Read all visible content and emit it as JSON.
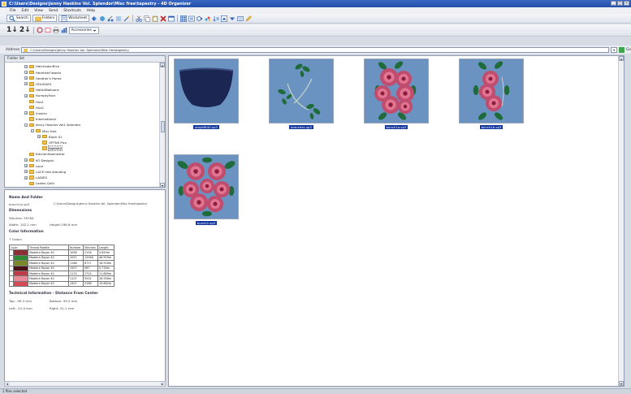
{
  "window": {
    "title": "C:\\Users\\Designs\\Jenny Haskins Vol. Splendor\\Misc free\\tapestry - 4D Organizer",
    "controls": [
      "_",
      "□",
      "×"
    ]
  },
  "menu": [
    "File",
    "Edit",
    "View",
    "Send",
    "Shortcuts",
    "Help"
  ],
  "toolbar1": {
    "search_label": "Search",
    "folders_label": "Folders",
    "worksheet_label": "Worksheet"
  },
  "toolbar2": {
    "sort1_label": "1↓",
    "sort2_label": "2↓",
    "accessories_label": "Accessories"
  },
  "address": {
    "label": "Address",
    "path": "C:\\Users\\Designs\\Jenny Haskins Vol. Splendor\\Misc free\\tapestry",
    "go_label": "Go"
  },
  "folder_list": {
    "header": "Folder list",
    "items": [
      {
        "label": "HatchedsnRice",
        "depth": 1,
        "expander": "+"
      },
      {
        "label": "HeartishFlowers",
        "depth": 1,
        "expander": "+"
      },
      {
        "label": "Heather's Home",
        "depth": 1,
        "expander": "+"
      },
      {
        "label": "HOLIDAYS",
        "depth": 1,
        "expander": "+"
      },
      {
        "label": "HotAirBalloons",
        "depth": 1,
        "expander": ""
      },
      {
        "label": "HumptyFace",
        "depth": 1,
        "expander": "+"
      },
      {
        "label": "Hus1",
        "depth": 1,
        "expander": ""
      },
      {
        "label": "Hus2",
        "depth": 1,
        "expander": ""
      },
      {
        "label": "Insects",
        "depth": 1,
        "expander": "+"
      },
      {
        "label": "International",
        "depth": 1,
        "expander": ""
      },
      {
        "label": "Jenny Haskins Vol1 Splendor",
        "depth": 1,
        "expander": "−"
      },
      {
        "label": "Misc free",
        "depth": 2,
        "expander": "−"
      },
      {
        "label": "Block 01",
        "depth": 3,
        "expander": "+"
      },
      {
        "label": "OPTNS Pics",
        "depth": 3,
        "expander": ""
      },
      {
        "label": "tapestry",
        "depth": 3,
        "expander": "",
        "selected": true
      },
      {
        "label": "KitchenHolenester",
        "depth": 1,
        "expander": ""
      },
      {
        "label": "KO Designs",
        "depth": 1,
        "expander": "+"
      },
      {
        "label": "Lace",
        "depth": 1,
        "expander": "+"
      },
      {
        "label": "LACE free standing",
        "depth": 1,
        "expander": "+"
      },
      {
        "label": "LADIES",
        "depth": 1,
        "expander": "+"
      },
      {
        "label": "Ladies Quilt",
        "depth": 1,
        "expander": ""
      }
    ]
  },
  "info": {
    "name_heading": "Name And Folder",
    "file_name": "bunch1a.vp3",
    "file_path": "C:\\Users\\Designs\\Jenny Haskins Vol. Splendor\\Misc free\\tapestry",
    "dimensions_heading": "Dimensions",
    "stitches": "Stitches: 39784",
    "width": "Width: 102.1 mm",
    "height": "Height:198.8 mm",
    "color_heading": "Color Information",
    "colors_count": "7 Colors",
    "table_headers": [
      "Color",
      "Thread Palette",
      "Number",
      "Stitches",
      "Length"
    ],
    "color_rows": [
      {
        "swatch": "#8a2f35",
        "palette": "Madeira Rayon 40",
        "number": "1058",
        "stitches": "2126",
        "length": "5.829m"
      },
      {
        "swatch": "#2f8a35",
        "palette": "Madeira Rayon 40",
        "number": "1051",
        "stitches": "12946",
        "length": "46.559m"
      },
      {
        "swatch": "#7a8a2a",
        "palette": "Madeira Rayon 40",
        "number": "1166",
        "stitches": "6717",
        "length": "16.918m"
      },
      {
        "swatch": "#4a1018",
        "palette": "Madeira Rayon 40",
        "number": "1507",
        "stitches": "567",
        "length": "0.718m"
      },
      {
        "swatch": "#c23a48",
        "palette": "Madeira Rayon 40",
        "number": "1174",
        "stitches": "2725",
        "length": "11.889m"
      },
      {
        "swatch": "#e88a9a",
        "palette": "Madeira Rayon 40",
        "number": "1107",
        "stitches": "5931",
        "length": "26.956m"
      },
      {
        "swatch": "#d84a52",
        "palette": "Madeira Rayon 40",
        "number": "1307",
        "stitches": "2166",
        "length": "19.662m"
      }
    ],
    "tech_heading": "Technical Information - Distance From Center",
    "top": "Top: -99.3 mm",
    "bottom": "Bottom: 99.5 mm",
    "left": "Left: -51.0 mm",
    "right": "Right: 51.1 mm"
  },
  "thumbnails": [
    {
      "label": "amphflt40.vp3",
      "design": "pot"
    },
    {
      "label": "branches.vp3",
      "design": "branches"
    },
    {
      "label": "bunch1a.vp3",
      "design": "bunch-v"
    },
    {
      "label": "bunch1b.vp3",
      "design": "bunch-v2"
    },
    {
      "label": "bunch2.vp3",
      "design": "bunch-h"
    }
  ],
  "status": {
    "text": "1 files selected"
  },
  "colors": {
    "selection": "#14379e",
    "thumb_bg": "#6b93c2",
    "pot": "#1b2752",
    "leaf": "#1f6b3b",
    "rose": "#c04c6e",
    "rose_light": "#e27592"
  }
}
